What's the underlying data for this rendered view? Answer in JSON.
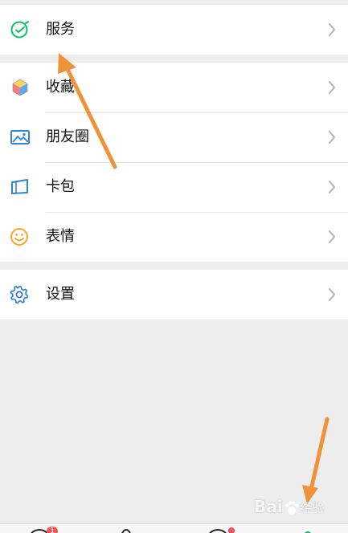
{
  "menu": {
    "services": {
      "label": "服务",
      "icon": "services-icon"
    },
    "favorites": {
      "label": "收藏",
      "icon": "favorites-cube-icon"
    },
    "moments": {
      "label": "朋友圈",
      "icon": "moments-image-icon"
    },
    "cards": {
      "label": "卡包",
      "icon": "cards-wallet-icon"
    },
    "stickers": {
      "label": "表情",
      "icon": "stickers-smile-icon"
    },
    "settings": {
      "label": "设置",
      "icon": "settings-gear-icon"
    }
  },
  "tabbar": {
    "chats_badge": "1",
    "active_color": "#07c160",
    "badge_color": "#fa5151"
  },
  "annotation": {
    "arrow_color": "#f0923a"
  },
  "watermark": {
    "brand": "Bai",
    "sub": "经验"
  },
  "colors": {
    "background": "#ededed",
    "card": "#ffffff",
    "services_icon": "#07c160",
    "settings_icon": "#2c7bd6",
    "stickers_icon": "#f5a623"
  }
}
